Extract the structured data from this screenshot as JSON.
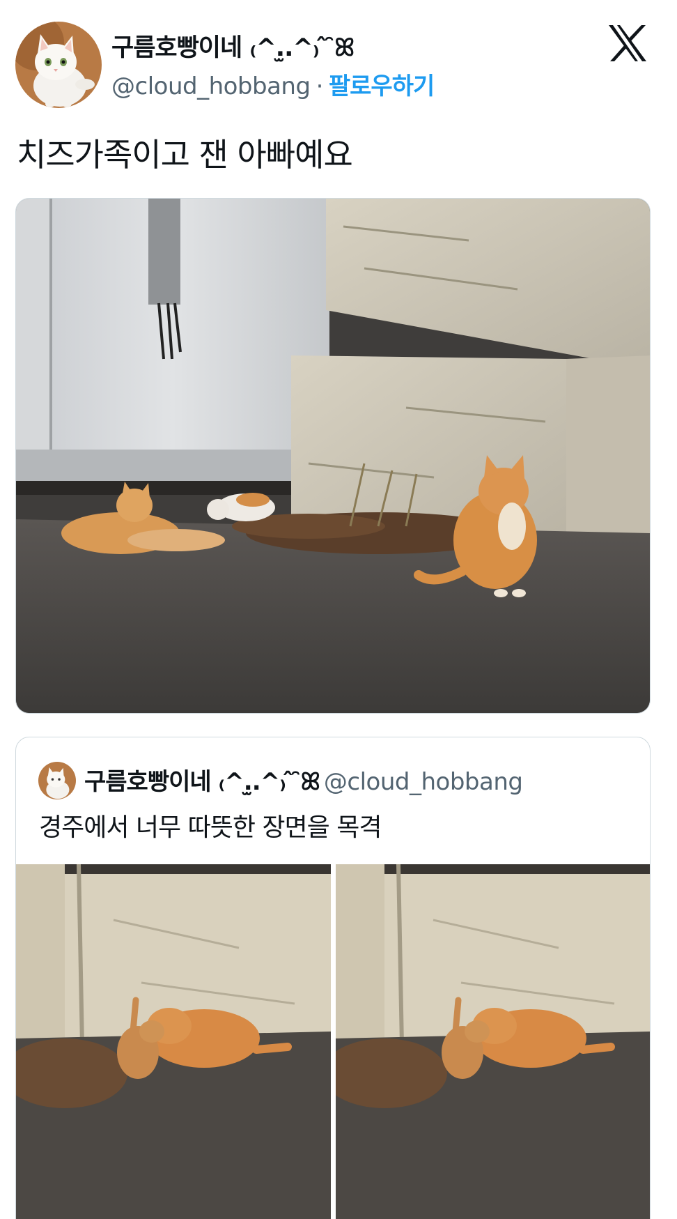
{
  "author": {
    "display_name": "구름호빵이네 ₍^.̫.^₎ ̂ ̑ꕤ",
    "handle": "@cloud_hobbang",
    "separator": "·",
    "follow_label": "팔로우하기"
  },
  "tweet": {
    "text": "치즈가족이고 잰 아빠예요"
  },
  "quoted_tweet": {
    "display_name": "구름호빵이네 ₍^.̫.^₎ ̂ ̑ꕤ",
    "handle": "@cloud_hobbang",
    "text": "경주에서 너무 따뜻한 장면을 목격"
  },
  "icons": {
    "logo": "x-logo-icon",
    "avatar": "white-cat-avatar",
    "main_photo": "cats-by-concrete-wall-photo",
    "quote_photo_1": "cat-and-kitten-photo",
    "quote_photo_2": "cat-and-kitten-photo"
  },
  "colors": {
    "text_primary": "#0f1419",
    "text_secondary": "#536471",
    "link": "#1d9bf0",
    "border": "#cfd9de"
  }
}
